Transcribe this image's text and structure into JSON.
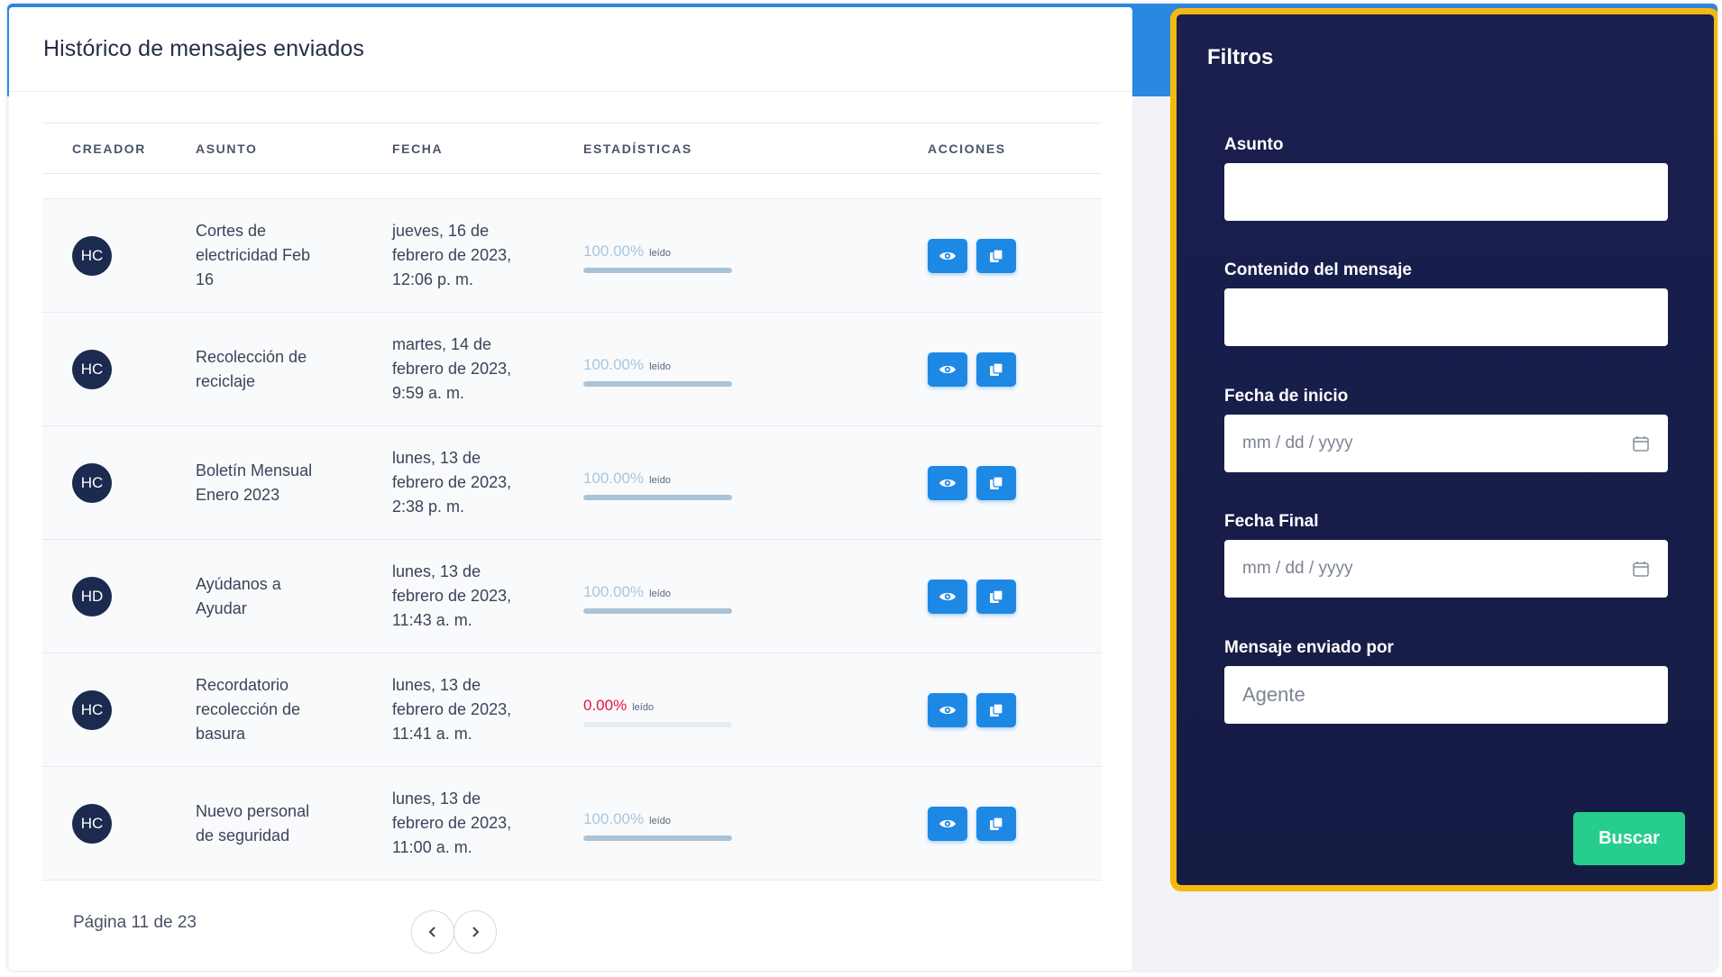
{
  "card": {
    "title": "Histórico de mensajes enviados"
  },
  "table": {
    "headers": {
      "creator": "CREADOR",
      "subject": "ASUNTO",
      "date": "FECHA",
      "stats": "ESTADÍSTICAS",
      "actions": "ACCIONES"
    },
    "rows": [
      {
        "initials": "HC",
        "subject": "Cortes de electricidad Feb 16",
        "date": "jueves, 16 de febrero de 2023, 12:06 p. m.",
        "pct": "100.00%",
        "read_label": "leído",
        "read_fraction": 1.0
      },
      {
        "initials": "HC",
        "subject": "Recolección de reciclaje",
        "date": "martes, 14 de febrero de 2023, 9:59 a. m.",
        "pct": "100.00%",
        "read_label": "leído",
        "read_fraction": 1.0
      },
      {
        "initials": "HC",
        "subject": "Boletín Mensual Enero 2023",
        "date": "lunes, 13 de febrero de 2023, 2:38 p. m.",
        "pct": "100.00%",
        "read_label": "leído",
        "read_fraction": 1.0
      },
      {
        "initials": "HD",
        "subject": "Ayúdanos a Ayudar",
        "date": "lunes, 13 de febrero de 2023, 11:43 a. m.",
        "pct": "100.00%",
        "read_label": "leído",
        "read_fraction": 1.0
      },
      {
        "initials": "HC",
        "subject": "Recordatorio recolección de basura",
        "date": "lunes, 13 de febrero de 2023, 11:41 a. m.",
        "pct": "0.00%",
        "read_label": "leído",
        "read_fraction": 0.0
      },
      {
        "initials": "HC",
        "subject": "Nuevo personal de seguridad",
        "date": "lunes, 13 de febrero de 2023, 11:00 a. m.",
        "pct": "100.00%",
        "read_label": "leído",
        "read_fraction": 1.0
      }
    ],
    "action_icons": [
      "eye-icon",
      "copy-icon"
    ]
  },
  "pagination": {
    "text": "Página 11 de 23",
    "prev_icon": "chevron-left-icon",
    "next_icon": "chevron-right-icon"
  },
  "filters": {
    "title": "Filtros",
    "subject_label": "Asunto",
    "subject_value": "",
    "content_label": "Contenido del mensaje",
    "content_value": "",
    "start_label": "Fecha de inicio",
    "start_placeholder": "mm / dd / yyyy",
    "end_label": "Fecha Final",
    "end_placeholder": "mm / dd / yyyy",
    "sender_label": "Mensaje enviado por",
    "sender_placeholder": "Agente",
    "search_button": "Buscar"
  },
  "colors": {
    "accent": "#1e88e5",
    "panel_bg": "#1a1f4f",
    "panel_border": "#f5b90e",
    "search_button": "#27cd8c",
    "zero_pct": "#e8133b",
    "avatar": "#1b2a4e"
  }
}
